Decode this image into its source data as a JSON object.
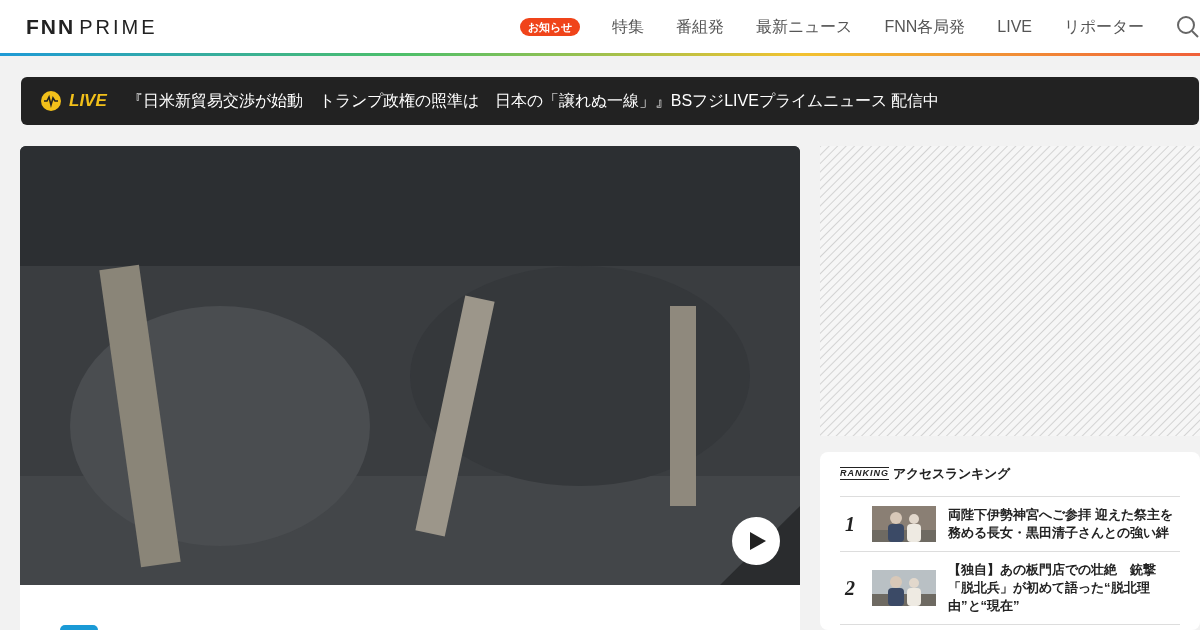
{
  "header": {
    "logo_mark": "FNN",
    "logo_text": "PRIME",
    "notice_badge": "お知らせ",
    "nav": [
      {
        "label": "特集"
      },
      {
        "label": "番組発"
      },
      {
        "label": "最新ニュース"
      },
      {
        "label": "FNN各局発"
      },
      {
        "label": "LIVE"
      },
      {
        "label": "リポーター"
      }
    ]
  },
  "live_ticker": {
    "label": "LIVE",
    "text": "『日米新貿易交渉が始動　トランプ政権の照準は　日本の「譲れぬ一線」』BSフジLIVEプライムニュース 配信中"
  },
  "ranking": {
    "logo": "RANKING",
    "title": "アクセスランキング",
    "items": [
      {
        "rank": "1",
        "title": "両陛下伊勢神宮へご参拝 迎えた祭主を務める長女・黒田清子さんとの強い絆"
      },
      {
        "rank": "2",
        "title": "【独自】あの板門店での壮絶　銃撃「脱北兵」が初めて語った“脱北理由”と“現在”"
      }
    ]
  }
}
